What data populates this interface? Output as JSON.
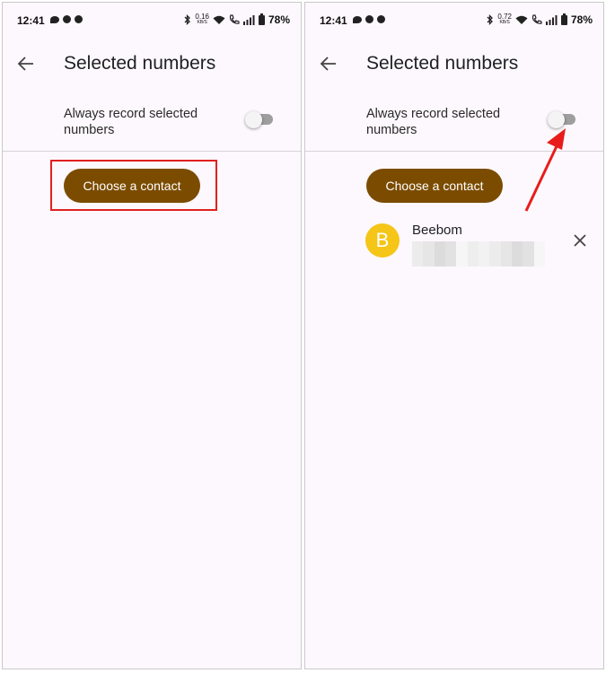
{
  "left": {
    "status": {
      "time": "12:41",
      "speed_value": "0.16",
      "speed_unit": "KB/S",
      "battery": "78%"
    },
    "title": "Selected numbers",
    "setting_label": "Always record selected numbers",
    "toggle_on": false,
    "button_label": "Choose a contact"
  },
  "right": {
    "status": {
      "time": "12:41",
      "speed_value": "0.72",
      "speed_unit": "KB/S",
      "battery": "78%"
    },
    "title": "Selected numbers",
    "setting_label": "Always record selected numbers",
    "toggle_on": false,
    "button_label": "Choose a contact",
    "contact": {
      "initial": "B",
      "name": "Beebom"
    }
  },
  "colors": {
    "button_bg": "#7b4c00",
    "avatar_bg": "#f5c518",
    "highlight": "#e02020",
    "page_bg": "#fdf8fd"
  },
  "icons": [
    "back-arrow-icon",
    "close-icon",
    "bluetooth-icon",
    "wifi-icon",
    "call-icon",
    "signal-icon",
    "battery-icon",
    "chat-icon",
    "facebook-icon"
  ]
}
